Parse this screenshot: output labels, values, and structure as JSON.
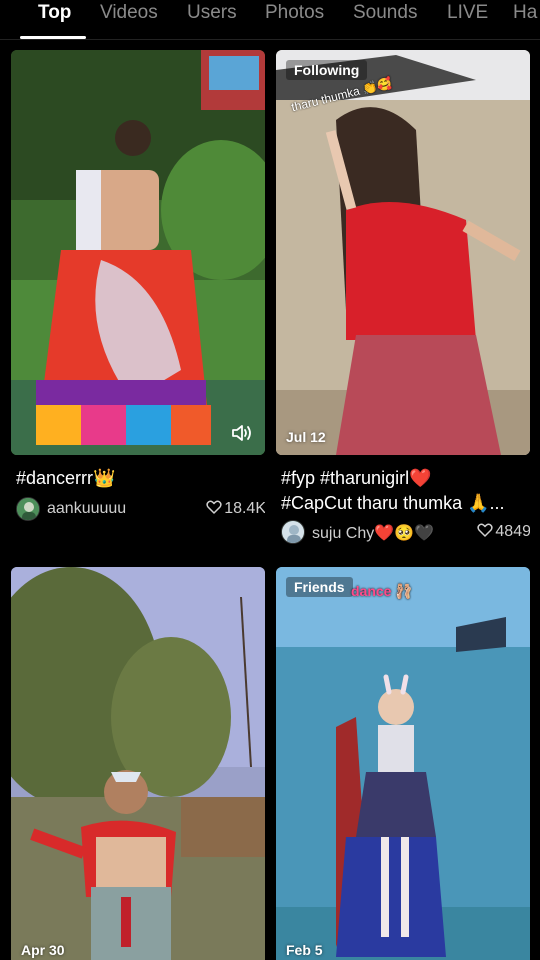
{
  "tabs": [
    {
      "label": "Top"
    },
    {
      "label": "Videos"
    },
    {
      "label": "Users"
    },
    {
      "label": "Photos"
    },
    {
      "label": "Sounds"
    },
    {
      "label": "LIVE"
    },
    {
      "label": "Ha"
    }
  ],
  "cards": [
    {
      "caption": "#dancerrr👑",
      "username": "aankuuuuu",
      "likes": "18.4K",
      "sound_icon": "speaker-icon"
    },
    {
      "badge": "Following",
      "overlay_text": "tharu thumka 👏🥰",
      "date": "Jul 12",
      "caption_line1": "#fyp #tharunigirl❤️",
      "caption_line2": "#CapCut tharu thumka 🙏...",
      "username": "suju Chy❤️🥺🖤",
      "likes": "4849"
    },
    {
      "date": "Apr 30"
    },
    {
      "badge": "Friends",
      "overlay_text": "dance 🩰",
      "date": "Feb 5"
    }
  ]
}
